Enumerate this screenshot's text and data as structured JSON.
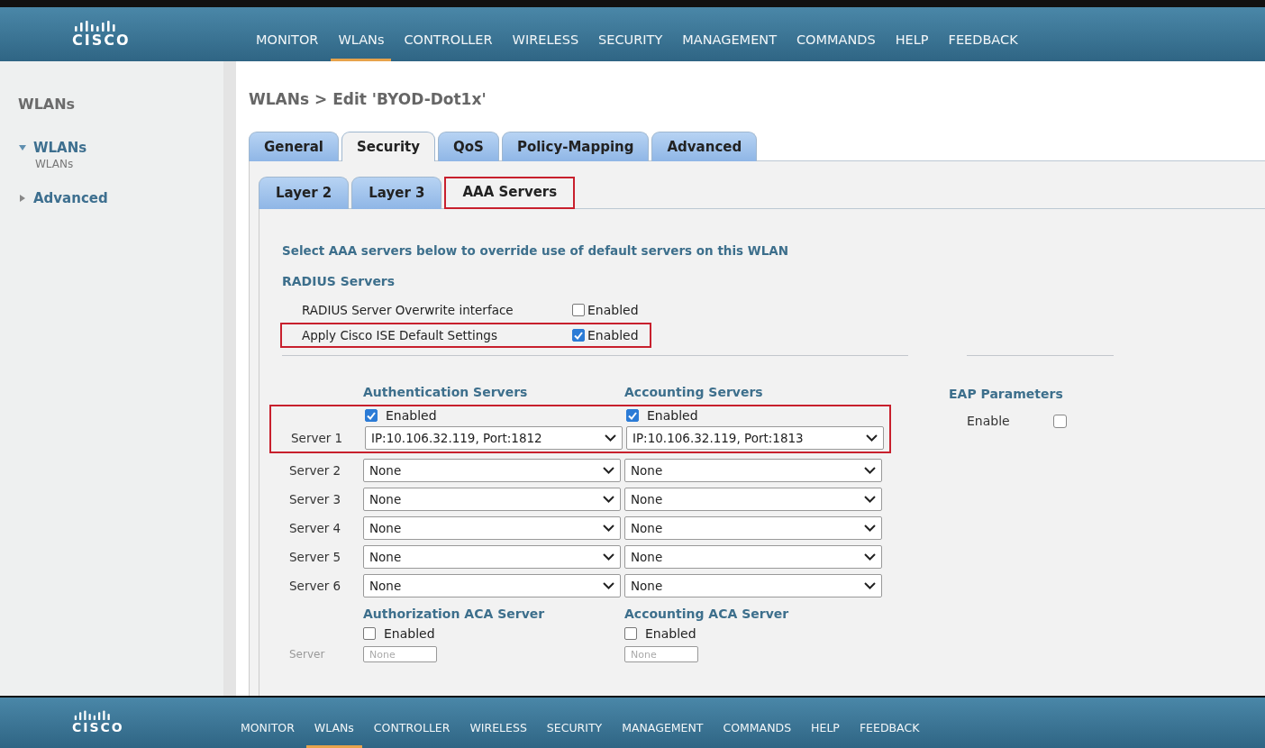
{
  "header": {
    "logo_text": "CISCO",
    "nav": [
      {
        "label": "MONITOR",
        "selected": false
      },
      {
        "label": "WLANs",
        "selected": true
      },
      {
        "label": "CONTROLLER",
        "selected": false
      },
      {
        "label": "WIRELESS",
        "selected": false
      },
      {
        "label": "SECURITY",
        "selected": false
      },
      {
        "label": "MANAGEMENT",
        "selected": false
      },
      {
        "label": "COMMANDS",
        "selected": false
      },
      {
        "label": "HELP",
        "selected": false
      },
      {
        "label": "FEEDBACK",
        "selected": false
      }
    ]
  },
  "sidebar": {
    "title": "WLANs",
    "items": [
      {
        "label": "WLANs",
        "expanded": true,
        "children": [
          {
            "label": "WLANs"
          }
        ]
      },
      {
        "label": "Advanced",
        "expanded": false
      }
    ]
  },
  "page_title": "WLANs > Edit  'BYOD-Dot1x'",
  "tabs": [
    {
      "label": "General",
      "selected": false
    },
    {
      "label": "Security",
      "selected": true
    },
    {
      "label": "QoS",
      "selected": false
    },
    {
      "label": "Policy-Mapping",
      "selected": false
    },
    {
      "label": "Advanced",
      "selected": false
    }
  ],
  "subtabs": [
    {
      "label": "Layer 2",
      "selected": false,
      "highlighted": false
    },
    {
      "label": "Layer 3",
      "selected": false,
      "highlighted": false
    },
    {
      "label": "AAA Servers",
      "selected": true,
      "highlighted": true
    }
  ],
  "intro": "Select AAA servers below to override use of default servers on this WLAN",
  "radius_heading": "RADIUS Servers",
  "options": [
    {
      "label": "RADIUS Server Overwrite interface",
      "checkbox_label": "Enabled",
      "checked": false,
      "highlighted": false
    },
    {
      "label": "Apply Cisco ISE Default Settings",
      "checkbox_label": "Enabled",
      "checked": true,
      "highlighted": true
    }
  ],
  "columns": [
    {
      "heading": "Authentication Servers",
      "checkbox_label": "Enabled",
      "checked": true
    },
    {
      "heading": "Accounting Servers",
      "checkbox_label": "Enabled",
      "checked": true
    }
  ],
  "servers": [
    {
      "label": "Server 1",
      "values": [
        "IP:10.106.32.119, Port:1812",
        "IP:10.106.32.119, Port:1813"
      ]
    },
    {
      "label": "Server 2",
      "values": [
        "None",
        "None"
      ]
    },
    {
      "label": "Server 3",
      "values": [
        "None",
        "None"
      ]
    },
    {
      "label": "Server 4",
      "values": [
        "None",
        "None"
      ]
    },
    {
      "label": "Server 5",
      "values": [
        "None",
        "None"
      ]
    },
    {
      "label": "Server 6",
      "values": [
        "None",
        "None"
      ]
    }
  ],
  "server_block": {
    "highlighted": true
  },
  "eap": {
    "heading": "EAP Parameters",
    "label": "Enable",
    "checked": false
  },
  "aca": {
    "label": "Server",
    "columns": [
      {
        "heading": "Authorization ACA Server",
        "checkbox_label": "Enabled",
        "checked": false,
        "value": "None"
      },
      {
        "heading": "Accounting ACA Server",
        "checkbox_label": "Enabled",
        "checked": false,
        "value": "None"
      }
    ]
  },
  "footer": {
    "logo_text": "CISCO",
    "nav": [
      {
        "label": "MONITOR",
        "selected": false
      },
      {
        "label": "WLANs",
        "selected": true
      },
      {
        "label": "CONTROLLER",
        "selected": false
      },
      {
        "label": "WIRELESS",
        "selected": false
      },
      {
        "label": "SECURITY",
        "selected": false
      },
      {
        "label": "MANAGEMENT",
        "selected": false
      },
      {
        "label": "COMMANDS",
        "selected": false
      },
      {
        "label": "HELP",
        "selected": false
      },
      {
        "label": "FEEDBACK",
        "selected": false
      }
    ]
  }
}
